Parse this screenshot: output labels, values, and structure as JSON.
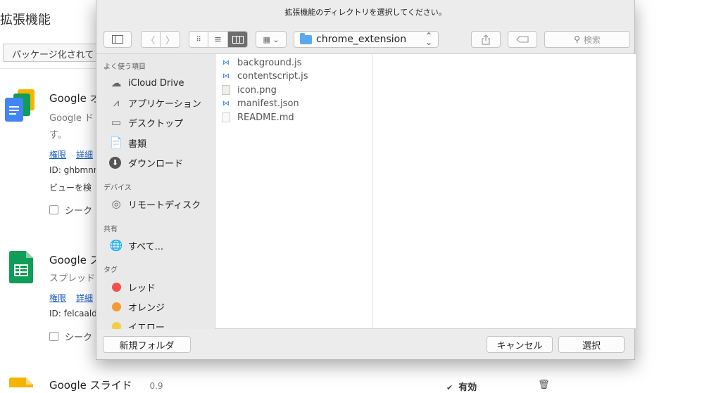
{
  "background": {
    "page_title": "拡張機能",
    "pack_button": "パッケージ化されて",
    "extensions": [
      {
        "name": "Google オ",
        "desc_line1": "Google ド",
        "desc_line2": "す。",
        "link_permissions": "権限",
        "link_details": "詳細",
        "id_text": "ID: ghbmnn",
        "view_text": "ビューを検",
        "checkbox_label": "シーク"
      },
      {
        "name": "Google ス",
        "desc_line1": "スプレッド",
        "link_permissions": "権限",
        "link_details": "詳細",
        "id_text": "ID: felcaald",
        "checkbox_label": "シーク"
      },
      {
        "name": "Google スライド",
        "version": "0.9"
      }
    ],
    "enabled_label": "有効"
  },
  "dialog": {
    "title": "拡張機能のディレクトリを選択してください。",
    "path_folder": "chrome_extension",
    "search_placeholder": "検索",
    "sidebar": {
      "favorites_header": "よく使う項目",
      "favorites": [
        {
          "label": "iCloud Drive",
          "icon": "cloud-icon"
        },
        {
          "label": "アプリケーション",
          "icon": "applications-icon"
        },
        {
          "label": "デスクトップ",
          "icon": "desktop-icon"
        },
        {
          "label": "書類",
          "icon": "documents-icon"
        },
        {
          "label": "ダウンロード",
          "icon": "downloads-icon"
        }
      ],
      "devices_header": "デバイス",
      "devices": [
        {
          "label": "リモートディスク",
          "icon": "disc-icon"
        }
      ],
      "shared_header": "共有",
      "shared": [
        {
          "label": "すべて...",
          "icon": "network-icon"
        }
      ],
      "tags_header": "タグ",
      "tags": [
        {
          "label": "レッド",
          "color": "#f0504f"
        },
        {
          "label": "オレンジ",
          "color": "#f59b35"
        },
        {
          "label": "イエロー",
          "color": "#f5cd41"
        }
      ]
    },
    "files": [
      {
        "name": "background.js",
        "icon": "vscode-file-icon"
      },
      {
        "name": "contentscript.js",
        "icon": "vscode-file-icon"
      },
      {
        "name": "icon.png",
        "icon": "image-file-icon"
      },
      {
        "name": "manifest.json",
        "icon": "vscode-file-icon"
      },
      {
        "name": "README.md",
        "icon": "blank-file-icon"
      }
    ],
    "new_folder_button": "新規フォルダ",
    "cancel_button": "キャンセル",
    "select_button": "選択"
  }
}
